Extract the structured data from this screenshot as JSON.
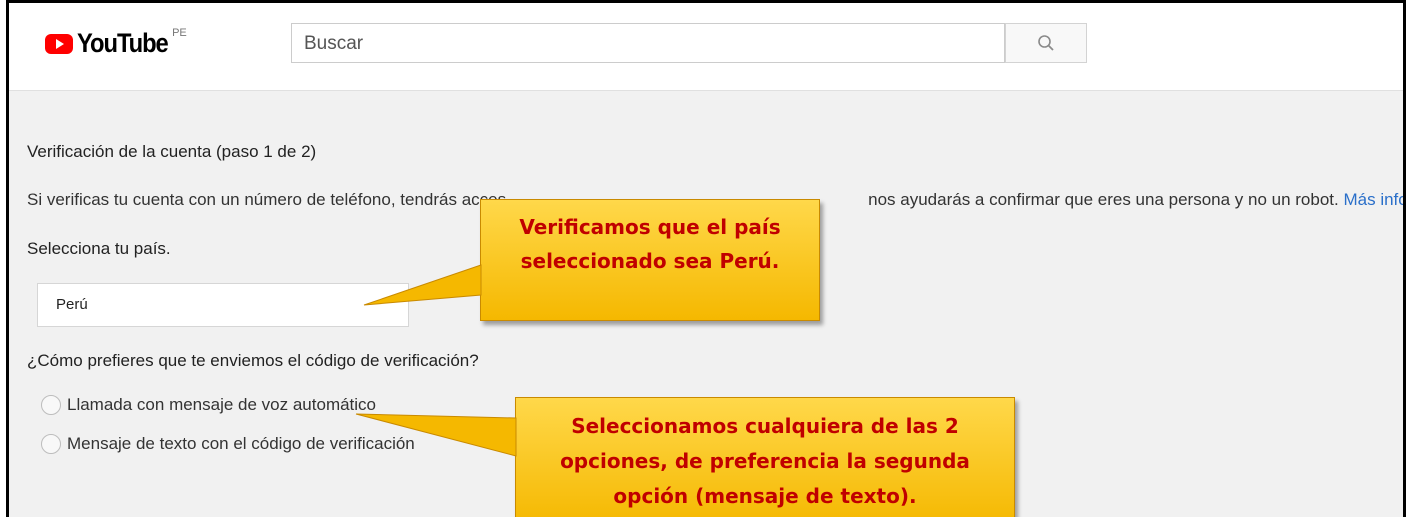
{
  "header": {
    "logo_text": "YouTube",
    "country_code": "PE",
    "search_placeholder": "Buscar"
  },
  "page": {
    "title": "Verificación de la cuenta (paso 1 de 2)",
    "description_before": "Si verificas tu cuenta con un número de teléfono, tendrás acces",
    "description_after": "nos ayudarás a confirmar que eres una persona y no un robot.",
    "more_info_link": "Más información",
    "country_label": "Selecciona tu país.",
    "country_value": "Perú",
    "delivery_question": "¿Cómo prefieres que te enviemos el código de verificación?",
    "options": [
      {
        "label": "Llamada con mensaje de voz automático",
        "selected": false
      },
      {
        "label": "Mensaje de texto con el código de verificación",
        "selected": false
      }
    ]
  },
  "callouts": [
    {
      "lines": [
        "Verificamos que el país",
        "seleccionado sea Perú."
      ]
    },
    {
      "lines": [
        "Seleccionamos cualquiera de las 2",
        "opciones, de preferencia la segunda",
        "opción (mensaje de texto)."
      ]
    }
  ],
  "colors": {
    "brand_red": "#ff0000",
    "link_blue": "#2a6fc9",
    "callout_fill": "#f5b800",
    "callout_text": "#c00000"
  }
}
